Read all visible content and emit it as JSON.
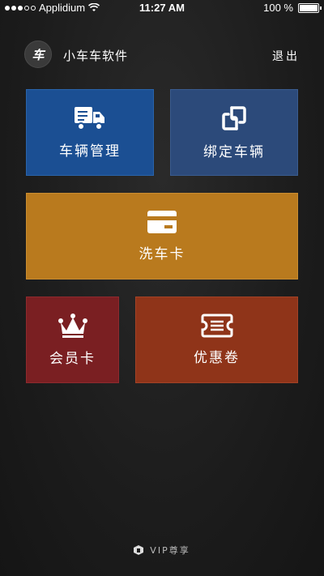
{
  "status_bar": {
    "carrier": "Applidium",
    "time": "11:27 AM",
    "battery": "100 %"
  },
  "header": {
    "logo_text": "车",
    "title": "小车车软件",
    "logout_label": "退出"
  },
  "tiles": {
    "vehicle_management": {
      "label": "车辆管理",
      "icon": "truck-icon",
      "color": "#1b4f93"
    },
    "bind_vehicle": {
      "label": "绑定车辆",
      "icon": "link-icon",
      "color": "#2c4a7a"
    },
    "wash_card": {
      "label": "洗车卡",
      "icon": "card-icon",
      "color": "#b97a1e"
    },
    "member_card": {
      "label": "会员卡",
      "icon": "crown-icon",
      "color": "#7a1f22"
    },
    "coupon": {
      "label": "优惠卷",
      "icon": "ticket-icon",
      "color": "#8f3419"
    }
  },
  "footer": {
    "label": "VIP尊享",
    "icon": "vip-logo-icon"
  }
}
